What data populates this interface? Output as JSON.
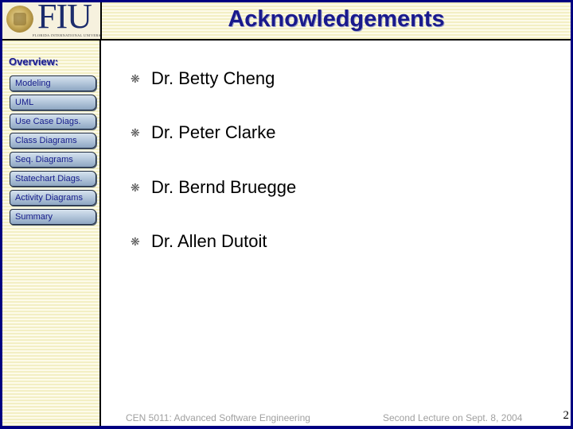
{
  "header": {
    "logo": {
      "wordmark": "FIU",
      "tagline": "FLORIDA INTERNATIONAL UNIVERSITY"
    },
    "title": "Acknowledgements"
  },
  "sidebar": {
    "heading": "Overview:",
    "items": [
      {
        "label": "Modeling"
      },
      {
        "label": "UML"
      },
      {
        "label": "Use Case Diags."
      },
      {
        "label": "Class Diagrams"
      },
      {
        "label": "Seq. Diagrams"
      },
      {
        "label": "Statechart Diags."
      },
      {
        "label": "Activity Diagrams"
      },
      {
        "label": "Summary"
      }
    ]
  },
  "content": {
    "bullet_glyph": "❋",
    "items": [
      {
        "text": "Dr. Betty Cheng"
      },
      {
        "text": "Dr. Peter Clarke"
      },
      {
        "text": "Dr. Bernd Bruegge"
      },
      {
        "text": "Dr. Allen Dutoit"
      }
    ]
  },
  "footer": {
    "course": "CEN 5011: Advanced Software Engineering",
    "lecture": "Second Lecture on Sept. 8, 2004",
    "page_number": "2"
  },
  "colors": {
    "frame": "#000080",
    "title": "#1a1a8c",
    "stripe_light": "#fdfbea",
    "stripe_dark": "#f3efc4"
  }
}
